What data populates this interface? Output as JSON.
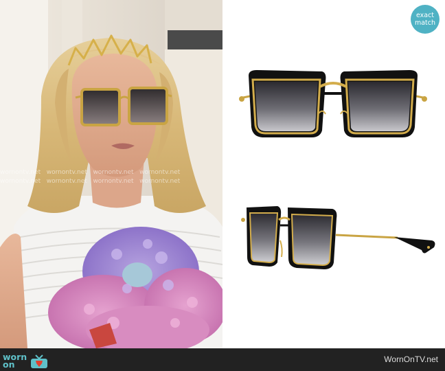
{
  "badge": {
    "line1": "exact",
    "line2": "match"
  },
  "watermark": "wornontv.net",
  "footer": {
    "logo_word_top": "worn",
    "logo_word_bottom": "on",
    "site": "WornOnTV.net"
  },
  "colors": {
    "badge_bg": "#4fb2c4",
    "footer_bg": "#222222",
    "brand_teal": "#5fc1c9",
    "brand_red": "#e3412f"
  }
}
